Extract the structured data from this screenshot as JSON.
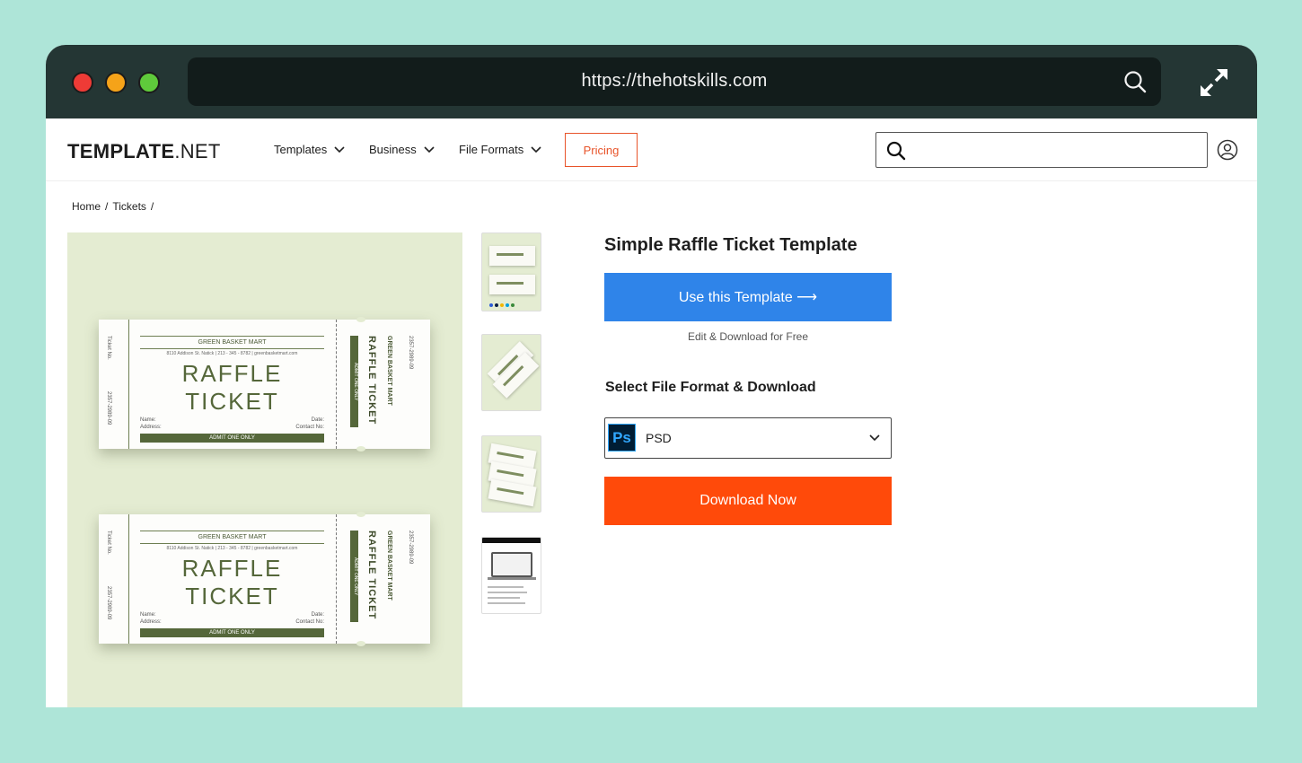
{
  "browser": {
    "url": "https://thehotskills.com"
  },
  "nav": {
    "logo_bold": "TEMPLATE",
    "logo_light": ".NET",
    "items": [
      {
        "label": "Templates"
      },
      {
        "label": "Business"
      },
      {
        "label": "File Formats"
      }
    ],
    "pricing_label": "Pricing",
    "search_placeholder": ""
  },
  "breadcrumb": {
    "items": [
      "Home",
      "/",
      "Tickets",
      "/"
    ]
  },
  "preview": {
    "tickets": [
      {
        "brand": "GREEN BASKET MART",
        "address": "8110 Addison St. Natick | 213 - 345 - 8782 | greenbasketmart.com",
        "title": "RAFFLE TICKET",
        "name_label": "Name:",
        "date_label": "Date:",
        "address_label": "Address:",
        "contact_label": "Contact No:",
        "admit": "ADMIT ONE ONLY",
        "ticket_no_label": "Ticket No.",
        "ticket_no": "2357-2989-09",
        "stub_title": "RAFFLE TICKET",
        "stub_brand": "GREEN BASKET MART",
        "stub_admit": "ADMIT ONE ONLY"
      },
      {
        "brand": "GREEN BASKET MART",
        "address": "8110 Addison St. Natick | 213 - 345 - 8782 | greenbasketmart.com",
        "title": "RAFFLE TICKET",
        "name_label": "Name:",
        "date_label": "Date:",
        "address_label": "Address:",
        "contact_label": "Contact No:",
        "admit": "ADMIT ONE ONLY",
        "ticket_no_label": "Ticket No.",
        "ticket_no": "2357-2989-09",
        "stub_title": "RAFFLE TICKET",
        "stub_brand": "GREEN BASKET MART",
        "stub_admit": "ADMIT ONE ONLY"
      }
    ]
  },
  "product": {
    "title": "Simple Raffle Ticket Template",
    "use_button": "Use this Template ⟶",
    "subnote": "Edit & Download for Free",
    "format_label": "Select File Format & Download",
    "format_icon": "Ps",
    "format_value": "PSD",
    "download_button": "Download Now"
  },
  "colors": {
    "accent_blue": "#2f84e9",
    "accent_orange": "#ff4a0a",
    "pricing_orange": "#e8542a",
    "ticket_green": "#55673a",
    "background_mint": "#aee5d8"
  }
}
